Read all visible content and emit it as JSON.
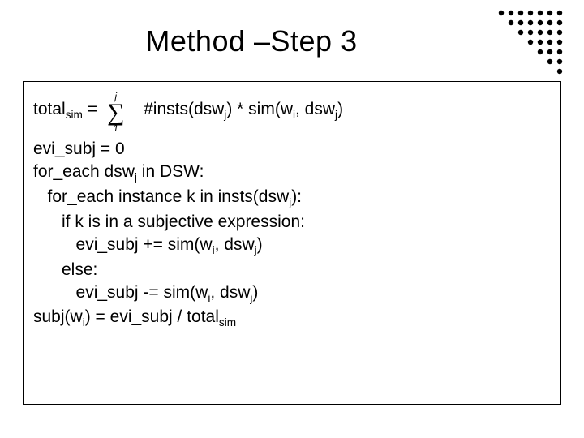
{
  "title": "Method –Step 3",
  "formula": {
    "lhs_base": "total",
    "lhs_sub": "sim",
    "eq": " = ",
    "sum_upper": "j",
    "sum_lower": "1",
    "rhs_a": "#insts(dsw",
    "rhs_a_sub": "j",
    "rhs_b": ") * sim(w",
    "rhs_b_sub": "i",
    "rhs_c": ", dsw",
    "rhs_c_sub": "j",
    "rhs_d": ")"
  },
  "algo": {
    "l1": "evi_subj = 0",
    "l2a": "for_each dsw",
    "l2_sub": "j",
    "l2b": " in DSW:",
    "l3a": "   for_each instance k in insts(dsw",
    "l3_sub": "j",
    "l3b": "):",
    "l4": "      if k is in a subjective expression:",
    "l5a": "         evi_subj += sim(w",
    "l5_sub1": "i",
    "l5b": ", dsw",
    "l5_sub2": "j",
    "l5c": ")",
    "l6": "      else:",
    "l7a": "         evi_subj -= sim(w",
    "l7_sub1": "i",
    "l7b": ", dsw",
    "l7_sub2": "j",
    "l7c": ")",
    "l8a": "subj(w",
    "l8_sub": "i",
    "l8b": ") = evi_subj / total",
    "l8_sub2": "sim"
  },
  "decor": {
    "dot_color": "#000000"
  }
}
